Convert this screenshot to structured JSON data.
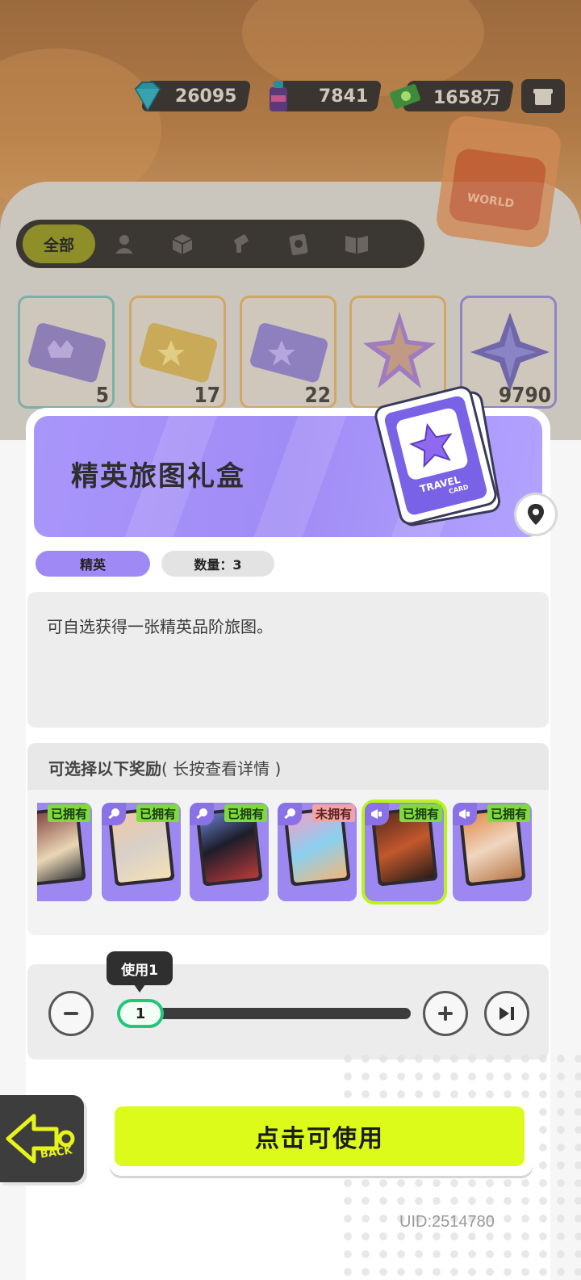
{
  "currencies": [
    {
      "name": "diamond",
      "icon": "diamond-icon",
      "amount": "26095"
    },
    {
      "name": "spray-can",
      "icon": "spray-can-icon",
      "amount": "7841"
    },
    {
      "name": "cash",
      "icon": "cash-icon",
      "amount": "1658万"
    }
  ],
  "categories": {
    "all_label": "全部",
    "icons": [
      "person-icon",
      "box-icon",
      "spray-gun-icon",
      "card-icon",
      "book-icon"
    ]
  },
  "inventory_slots": [
    {
      "icon": "crown-ticket-icon",
      "count": "5"
    },
    {
      "icon": "gold-ticket-icon",
      "count": "17"
    },
    {
      "icon": "star-ticket-icon",
      "count": "22"
    },
    {
      "icon": "rainbow-star-icon",
      "count": ""
    },
    {
      "icon": "purple-star-icon",
      "count": "9790"
    }
  ],
  "item": {
    "title": "精英旅图礼盒",
    "rarity": "精英",
    "quantity": "数量：3",
    "description": "可自选获得一张精英品阶旅图。",
    "badge_text_1": "TRAVEL",
    "badge_text_2": "CARD"
  },
  "rewards": {
    "title": "可选择以下奖励",
    "hint": "( 长按查看详情 )",
    "cards": [
      {
        "status": "已拥有",
        "owned": true,
        "selected": false
      },
      {
        "status": "已拥有",
        "owned": true,
        "selected": false
      },
      {
        "status": "已拥有",
        "owned": true,
        "selected": false
      },
      {
        "status": "未拥有",
        "owned": false,
        "selected": false
      },
      {
        "status": "已拥有",
        "owned": true,
        "selected": true
      },
      {
        "status": "已拥有",
        "owned": true,
        "selected": false
      }
    ]
  },
  "use": {
    "tooltip": "使用1",
    "value": "1"
  },
  "back_label": "BACK",
  "confirm_label": "点击可使用",
  "uid": "UID:2514780",
  "world_label": "WORLD",
  "colors": {
    "accent_lime": "#ddfb1b",
    "purple": "#a08cf5",
    "slider_green": "#21c77a"
  }
}
